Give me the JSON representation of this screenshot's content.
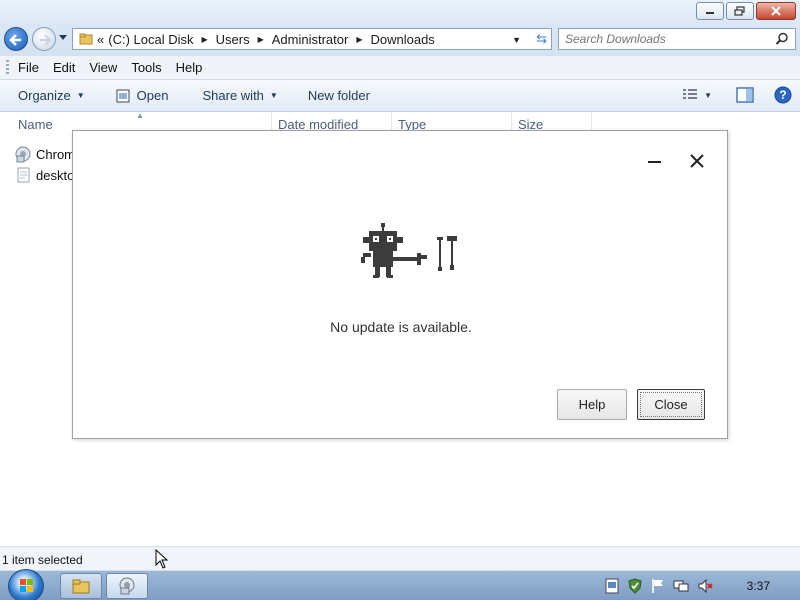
{
  "explorer": {
    "address": {
      "overflow": "«",
      "crumbs": [
        "(C:) Local Disk",
        "Users",
        "Administrator",
        "Downloads"
      ]
    },
    "search_placeholder": "Search Downloads",
    "menu": [
      "File",
      "Edit",
      "View",
      "Tools",
      "Help"
    ],
    "commands": {
      "organize": "Organize",
      "open": "Open",
      "share_with": "Share with",
      "new_folder": "New folder"
    },
    "columns": [
      "Name",
      "Date modified",
      "Type",
      "Size"
    ],
    "files": [
      "Chrom",
      "deskto"
    ],
    "status": "1 item selected"
  },
  "taskbar": {
    "clock": "3:37"
  },
  "dialog": {
    "message": "No update is available.",
    "help_label": "Help",
    "close_label": "Close"
  },
  "icons": {
    "back": "back-arrow-icon",
    "forward": "forward-arrow-icon",
    "refresh": "refresh-icon",
    "search": "search-icon",
    "open": "open-file-icon",
    "views": "views-icon",
    "preview_pane": "preview-pane-icon",
    "help": "help-icon",
    "robot": "broken-robot-icon",
    "tools": "tools-icon"
  },
  "colors": {
    "accent": "#1c5ec0",
    "taskbar": "#8ea9cc",
    "dialog_text": "#333333"
  }
}
